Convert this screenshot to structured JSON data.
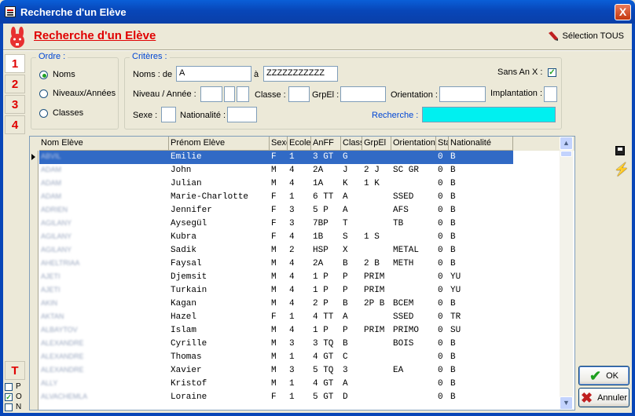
{
  "window": {
    "title": "Recherche d'un Elève",
    "close": "X"
  },
  "header": {
    "heading": "Recherche d'un Elève",
    "select_all": "Sélection TOUS"
  },
  "side_tabs": [
    "1",
    "2",
    "3",
    "4"
  ],
  "ordre": {
    "legend": "Ordre :",
    "options": [
      {
        "label": "Noms",
        "selected": true
      },
      {
        "label": "Niveaux/Années",
        "selected": false
      },
      {
        "label": "Classes",
        "selected": false
      }
    ]
  },
  "criteres": {
    "legend": "Critères :",
    "noms_de_label": "Noms : de",
    "noms_de_value": "A",
    "a_label": "à",
    "a_value": "ZZZZZZZZZZZ",
    "sans_an_x_label": "Sans An X :",
    "sans_an_x_checked": true,
    "niveau_label": "Niveau / Année :",
    "classe_label": "Classe :",
    "grpel_label": "GrpEl :",
    "orientation_label": "Orientation :",
    "implantation_label": "Implantation :",
    "sexe_label": "Sexe :",
    "nationalite_label": "Nationalité :",
    "recherche_label": "Recherche :",
    "recherche_value": ""
  },
  "table": {
    "columns": [
      "Nom Elève",
      "Prénom Elève",
      "Sexe",
      "Ecole",
      "AnFF",
      "Classe",
      "GrpEl",
      "Orientation",
      "Statut",
      "Nationalité"
    ],
    "rows": [
      {
        "nom": "ABVIL",
        "prenom": "Emilie",
        "sexe": "F",
        "ecole": "1",
        "anff": "3 GT",
        "classe": "G",
        "grpel": "",
        "orientation": "",
        "statut": "0",
        "nat": "B"
      },
      {
        "nom": "ADAM",
        "prenom": "John",
        "sexe": "M",
        "ecole": "4",
        "anff": "2A",
        "classe": "J",
        "grpel": "2 J",
        "orientation": "SC GR",
        "statut": "0",
        "nat": "B"
      },
      {
        "nom": "ADAM",
        "prenom": "Julian",
        "sexe": "M",
        "ecole": "4",
        "anff": "1A",
        "classe": "K",
        "grpel": "1 K",
        "orientation": "",
        "statut": "0",
        "nat": "B"
      },
      {
        "nom": "ADAM",
        "prenom": "Marie-Charlotte",
        "sexe": "F",
        "ecole": "1",
        "anff": "6 TT",
        "classe": "A",
        "grpel": "",
        "orientation": "SSED",
        "statut": "0",
        "nat": "B"
      },
      {
        "nom": "ADRIEN",
        "prenom": "Jennifer",
        "sexe": "F",
        "ecole": "3",
        "anff": "5 P",
        "classe": "A",
        "grpel": "",
        "orientation": "AFS",
        "statut": "0",
        "nat": "B"
      },
      {
        "nom": "AGILANY",
        "prenom": "Aysegül",
        "sexe": "F",
        "ecole": "3",
        "anff": "7BP",
        "classe": "T",
        "grpel": "",
        "orientation": "TB",
        "statut": "0",
        "nat": "B"
      },
      {
        "nom": "AGILANY",
        "prenom": "Kubra",
        "sexe": "F",
        "ecole": "4",
        "anff": "1B",
        "classe": "S",
        "grpel": "1 S",
        "orientation": "",
        "statut": "0",
        "nat": "B"
      },
      {
        "nom": "AGILANY",
        "prenom": "Sadik",
        "sexe": "M",
        "ecole": "2",
        "anff": "HSP",
        "classe": "X",
        "grpel": "",
        "orientation": "METAL",
        "statut": "0",
        "nat": "B"
      },
      {
        "nom": "AHELTRIAA",
        "prenom": "Faysal",
        "sexe": "M",
        "ecole": "4",
        "anff": "2A",
        "classe": "B",
        "grpel": "2 B",
        "orientation": "METH",
        "statut": "0",
        "nat": "B"
      },
      {
        "nom": "AJETI",
        "prenom": "Djemsit",
        "sexe": "M",
        "ecole": "4",
        "anff": "1 P",
        "classe": "P",
        "grpel": "PRIM",
        "orientation": "",
        "statut": "0",
        "nat": "YU"
      },
      {
        "nom": "AJETI",
        "prenom": "Turkain",
        "sexe": "M",
        "ecole": "4",
        "anff": "1 P",
        "classe": "P",
        "grpel": "PRIM",
        "orientation": "",
        "statut": "0",
        "nat": "YU"
      },
      {
        "nom": "AKIN",
        "prenom": "Kagan",
        "sexe": "M",
        "ecole": "4",
        "anff": "2 P",
        "classe": "B",
        "grpel": "2P B",
        "orientation": "BCEM",
        "statut": "0",
        "nat": "B"
      },
      {
        "nom": "AKTAN",
        "prenom": "Hazel",
        "sexe": "F",
        "ecole": "1",
        "anff": "4 TT",
        "classe": "A",
        "grpel": "",
        "orientation": "SSED",
        "statut": "0",
        "nat": "TR"
      },
      {
        "nom": "ALBAYTOV",
        "prenom": "Islam",
        "sexe": "M",
        "ecole": "4",
        "anff": "1 P",
        "classe": "P",
        "grpel": "PRIM",
        "orientation": "PRIMO",
        "statut": "0",
        "nat": "SU"
      },
      {
        "nom": "ALEXANDRE",
        "prenom": "Cyrille",
        "sexe": "M",
        "ecole": "3",
        "anff": "3 TQ",
        "classe": "B",
        "grpel": "",
        "orientation": "BOIS",
        "statut": "0",
        "nat": "B"
      },
      {
        "nom": "ALEXANDRE",
        "prenom": "Thomas",
        "sexe": "M",
        "ecole": "1",
        "anff": "4 GT",
        "classe": "C",
        "grpel": "",
        "orientation": "",
        "statut": "0",
        "nat": "B"
      },
      {
        "nom": "ALEXANDRE",
        "prenom": "Xavier",
        "sexe": "M",
        "ecole": "3",
        "anff": "5 TQ",
        "classe": "3",
        "grpel": "",
        "orientation": "EA",
        "statut": "0",
        "nat": "B"
      },
      {
        "nom": "ALLY",
        "prenom": "Kristof",
        "sexe": "M",
        "ecole": "1",
        "anff": "4 GT",
        "classe": "A",
        "grpel": "",
        "orientation": "",
        "statut": "0",
        "nat": "B"
      },
      {
        "nom": "ALVACHEMLA",
        "prenom": "Loraine",
        "sexe": "F",
        "ecole": "1",
        "anff": "5 GT",
        "classe": "D",
        "grpel": "",
        "orientation": "",
        "statut": "0",
        "nat": "B"
      }
    ]
  },
  "buttons": {
    "ok": "OK",
    "cancel": "Annuler"
  },
  "bottom_left": {
    "t_tab": "T",
    "options": [
      {
        "label": "P",
        "checked": false
      },
      {
        "label": "O",
        "checked": true
      },
      {
        "label": "N",
        "checked": false
      }
    ]
  },
  "colors": {
    "selection": "#316AC5",
    "accent_red": "#E00000",
    "recherche_bg": "#00F0F0",
    "titlebar": "#0846B8"
  }
}
